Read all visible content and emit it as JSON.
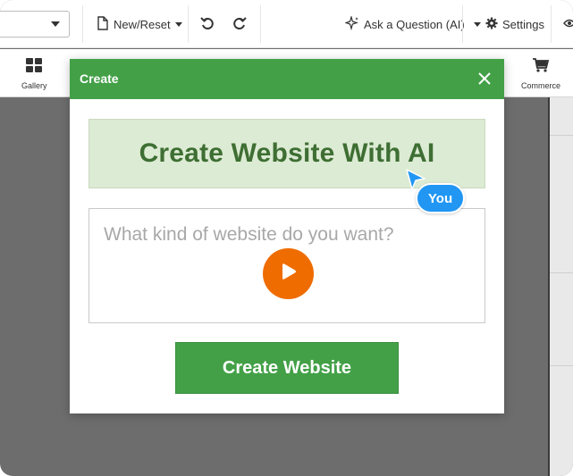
{
  "topbar": {
    "new_reset_label": "New/Reset",
    "ask_label": "Ask a Question (AI)",
    "settings_label": "Settings"
  },
  "toolbar2": {
    "gallery_label": "Gallery",
    "commerce_label": "Commerce"
  },
  "modal": {
    "title": "Create",
    "heading": "Create Website With AI",
    "prompt_placeholder": "What kind of website do you want?",
    "cursor_label": "You",
    "submit_label": "Create Website"
  },
  "colors": {
    "accent_green": "#43a047",
    "banner_green": "#dcebd3",
    "heading_green": "#3e6e33",
    "play_orange": "#ef6c00",
    "cursor_blue": "#2196f3"
  },
  "icons": [
    "page-icon",
    "undo-icon",
    "redo-icon",
    "sparkle-icon",
    "gear-icon",
    "gallery-icon",
    "cart-icon",
    "close-icon",
    "play-icon",
    "cursor-icon"
  ]
}
